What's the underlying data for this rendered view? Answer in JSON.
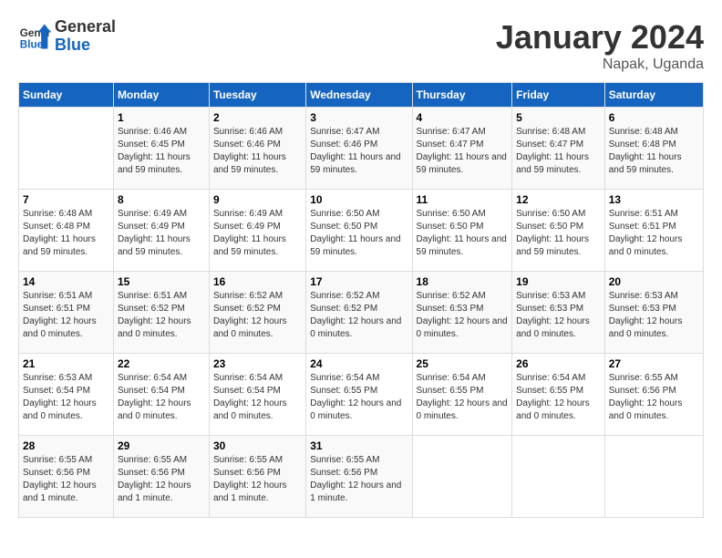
{
  "header": {
    "logo_line1": "General",
    "logo_line2": "Blue",
    "month_title": "January 2024",
    "location": "Napak, Uganda"
  },
  "days_of_week": [
    "Sunday",
    "Monday",
    "Tuesday",
    "Wednesday",
    "Thursday",
    "Friday",
    "Saturday"
  ],
  "weeks": [
    [
      {
        "day": "",
        "sunrise": "",
        "sunset": "",
        "daylight": ""
      },
      {
        "day": "1",
        "sunrise": "Sunrise: 6:46 AM",
        "sunset": "Sunset: 6:45 PM",
        "daylight": "Daylight: 11 hours and 59 minutes."
      },
      {
        "day": "2",
        "sunrise": "Sunrise: 6:46 AM",
        "sunset": "Sunset: 6:46 PM",
        "daylight": "Daylight: 11 hours and 59 minutes."
      },
      {
        "day": "3",
        "sunrise": "Sunrise: 6:47 AM",
        "sunset": "Sunset: 6:46 PM",
        "daylight": "Daylight: 11 hours and 59 minutes."
      },
      {
        "day": "4",
        "sunrise": "Sunrise: 6:47 AM",
        "sunset": "Sunset: 6:47 PM",
        "daylight": "Daylight: 11 hours and 59 minutes."
      },
      {
        "day": "5",
        "sunrise": "Sunrise: 6:48 AM",
        "sunset": "Sunset: 6:47 PM",
        "daylight": "Daylight: 11 hours and 59 minutes."
      },
      {
        "day": "6",
        "sunrise": "Sunrise: 6:48 AM",
        "sunset": "Sunset: 6:48 PM",
        "daylight": "Daylight: 11 hours and 59 minutes."
      }
    ],
    [
      {
        "day": "7",
        "sunrise": "Sunrise: 6:48 AM",
        "sunset": "Sunset: 6:48 PM",
        "daylight": "Daylight: 11 hours and 59 minutes."
      },
      {
        "day": "8",
        "sunrise": "Sunrise: 6:49 AM",
        "sunset": "Sunset: 6:49 PM",
        "daylight": "Daylight: 11 hours and 59 minutes."
      },
      {
        "day": "9",
        "sunrise": "Sunrise: 6:49 AM",
        "sunset": "Sunset: 6:49 PM",
        "daylight": "Daylight: 11 hours and 59 minutes."
      },
      {
        "day": "10",
        "sunrise": "Sunrise: 6:50 AM",
        "sunset": "Sunset: 6:50 PM",
        "daylight": "Daylight: 11 hours and 59 minutes."
      },
      {
        "day": "11",
        "sunrise": "Sunrise: 6:50 AM",
        "sunset": "Sunset: 6:50 PM",
        "daylight": "Daylight: 11 hours and 59 minutes."
      },
      {
        "day": "12",
        "sunrise": "Sunrise: 6:50 AM",
        "sunset": "Sunset: 6:50 PM",
        "daylight": "Daylight: 11 hours and 59 minutes."
      },
      {
        "day": "13",
        "sunrise": "Sunrise: 6:51 AM",
        "sunset": "Sunset: 6:51 PM",
        "daylight": "Daylight: 12 hours and 0 minutes."
      }
    ],
    [
      {
        "day": "14",
        "sunrise": "Sunrise: 6:51 AM",
        "sunset": "Sunset: 6:51 PM",
        "daylight": "Daylight: 12 hours and 0 minutes."
      },
      {
        "day": "15",
        "sunrise": "Sunrise: 6:51 AM",
        "sunset": "Sunset: 6:52 PM",
        "daylight": "Daylight: 12 hours and 0 minutes."
      },
      {
        "day": "16",
        "sunrise": "Sunrise: 6:52 AM",
        "sunset": "Sunset: 6:52 PM",
        "daylight": "Daylight: 12 hours and 0 minutes."
      },
      {
        "day": "17",
        "sunrise": "Sunrise: 6:52 AM",
        "sunset": "Sunset: 6:52 PM",
        "daylight": "Daylight: 12 hours and 0 minutes."
      },
      {
        "day": "18",
        "sunrise": "Sunrise: 6:52 AM",
        "sunset": "Sunset: 6:53 PM",
        "daylight": "Daylight: 12 hours and 0 minutes."
      },
      {
        "day": "19",
        "sunrise": "Sunrise: 6:53 AM",
        "sunset": "Sunset: 6:53 PM",
        "daylight": "Daylight: 12 hours and 0 minutes."
      },
      {
        "day": "20",
        "sunrise": "Sunrise: 6:53 AM",
        "sunset": "Sunset: 6:53 PM",
        "daylight": "Daylight: 12 hours and 0 minutes."
      }
    ],
    [
      {
        "day": "21",
        "sunrise": "Sunrise: 6:53 AM",
        "sunset": "Sunset: 6:54 PM",
        "daylight": "Daylight: 12 hours and 0 minutes."
      },
      {
        "day": "22",
        "sunrise": "Sunrise: 6:54 AM",
        "sunset": "Sunset: 6:54 PM",
        "daylight": "Daylight: 12 hours and 0 minutes."
      },
      {
        "day": "23",
        "sunrise": "Sunrise: 6:54 AM",
        "sunset": "Sunset: 6:54 PM",
        "daylight": "Daylight: 12 hours and 0 minutes."
      },
      {
        "day": "24",
        "sunrise": "Sunrise: 6:54 AM",
        "sunset": "Sunset: 6:55 PM",
        "daylight": "Daylight: 12 hours and 0 minutes."
      },
      {
        "day": "25",
        "sunrise": "Sunrise: 6:54 AM",
        "sunset": "Sunset: 6:55 PM",
        "daylight": "Daylight: 12 hours and 0 minutes."
      },
      {
        "day": "26",
        "sunrise": "Sunrise: 6:54 AM",
        "sunset": "Sunset: 6:55 PM",
        "daylight": "Daylight: 12 hours and 0 minutes."
      },
      {
        "day": "27",
        "sunrise": "Sunrise: 6:55 AM",
        "sunset": "Sunset: 6:56 PM",
        "daylight": "Daylight: 12 hours and 0 minutes."
      }
    ],
    [
      {
        "day": "28",
        "sunrise": "Sunrise: 6:55 AM",
        "sunset": "Sunset: 6:56 PM",
        "daylight": "Daylight: 12 hours and 1 minute."
      },
      {
        "day": "29",
        "sunrise": "Sunrise: 6:55 AM",
        "sunset": "Sunset: 6:56 PM",
        "daylight": "Daylight: 12 hours and 1 minute."
      },
      {
        "day": "30",
        "sunrise": "Sunrise: 6:55 AM",
        "sunset": "Sunset: 6:56 PM",
        "daylight": "Daylight: 12 hours and 1 minute."
      },
      {
        "day": "31",
        "sunrise": "Sunrise: 6:55 AM",
        "sunset": "Sunset: 6:56 PM",
        "daylight": "Daylight: 12 hours and 1 minute."
      },
      {
        "day": "",
        "sunrise": "",
        "sunset": "",
        "daylight": ""
      },
      {
        "day": "",
        "sunrise": "",
        "sunset": "",
        "daylight": ""
      },
      {
        "day": "",
        "sunrise": "",
        "sunset": "",
        "daylight": ""
      }
    ]
  ]
}
